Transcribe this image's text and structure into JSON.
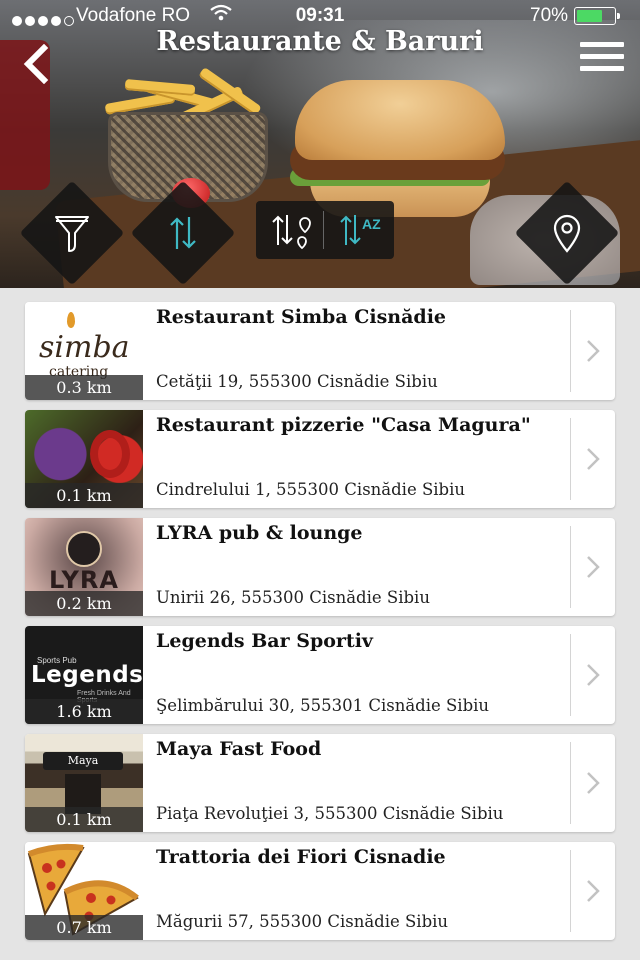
{
  "status_bar": {
    "carrier": "Vodafone RO",
    "time": "09:31",
    "battery_percent": "70%",
    "battery_level": 0.7,
    "signal_bars_filled": 4,
    "signal_bars_total": 5
  },
  "header": {
    "title": "Restaurante & Baruri",
    "back_icon": "chevron-left-icon",
    "menu_icon": "hamburger-menu-icon"
  },
  "actions": {
    "filter_icon": "funnel-icon",
    "sort_icon": "sort-arrows-icon",
    "sort_distance_icon": "sort-by-distance-icon",
    "sort_alpha_icon": "sort-az-icon",
    "sort_alpha_letters": "AZ",
    "map_icon": "map-pin-icon",
    "accent_color": "#3fb9c4"
  },
  "places": [
    {
      "name": "Restaurant Simba Cisnădie",
      "address": "Cetăţii 19, 555300 Cisnădie Sibiu",
      "distance": "0.3 km",
      "thumb_text": "simba",
      "thumb_subtext": "catering"
    },
    {
      "name": "Restaurant pizzerie \"Casa Magura\"",
      "address": "Cindrelului 1, 555300 Cisnădie Sibiu",
      "distance": "0.1 km"
    },
    {
      "name": "LYRA pub & lounge",
      "address": "Unirii 26, 555300 Cisnădie Sibiu",
      "distance": "0.2 km",
      "thumb_text": "LYRA"
    },
    {
      "name": "Legends Bar Sportiv",
      "address": "Şelimbărului 30, 555301 Cisnădie Sibiu",
      "distance": "1.6 km",
      "thumb_text": "Legends",
      "thumb_small": "Sports Pub",
      "thumb_tag": "Fresh Drinks And Sports"
    },
    {
      "name": "Maya Fast Food",
      "address": "Piaţa Revoluţiei 3, 555300 Cisnădie Sibiu",
      "distance": "0.1 km",
      "thumb_text": "Maya"
    },
    {
      "name": "Trattoria dei Fiori Cisnadie",
      "address": "Măgurii 57, 555300 Cisnădie Sibiu",
      "distance": "0.7 km"
    }
  ]
}
